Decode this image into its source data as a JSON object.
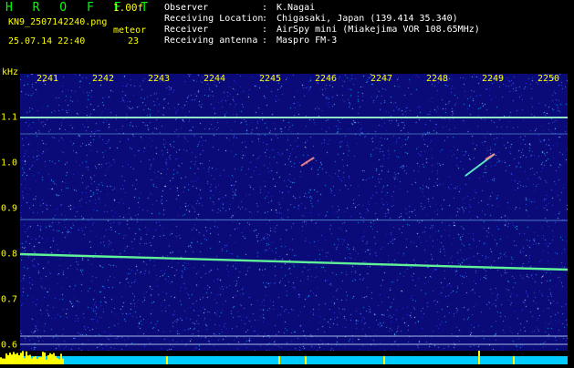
{
  "header": {
    "brand": "H R O F F T",
    "version": "1.00f",
    "filename": "KN9_2507142240.png",
    "meteor_title": "meteor",
    "datetime": "25.07.14 22:40",
    "meteor_count": "23",
    "info": [
      {
        "key": "Observer",
        "sep": ":",
        "value": "K.Nagai"
      },
      {
        "key": "Receiving Location",
        "sep": ":",
        "value": "Chigasaki, Japan (139.414 35.340)"
      },
      {
        "key": "Receiver",
        "sep": ":",
        "value": "AirSpy mini (Miakejima VOR 108.65MHz)"
      },
      {
        "key": "Receiving antenna",
        "sep": ":",
        "value": "Maspro FM-3"
      }
    ]
  },
  "axis": {
    "unit": "kHz",
    "time_ticks": [
      "2241",
      "2242",
      "2243",
      "2244",
      "2245",
      "2246",
      "2247",
      "2248",
      "2249",
      "2250"
    ],
    "freq_ticks": [
      "1.1",
      "1.0",
      "0.9",
      "0.8",
      "0.7",
      "0.6"
    ]
  },
  "colors": {
    "label": "#ffff00",
    "info": "#ffffff",
    "brand": "#00ff00",
    "background": "#0a0a78",
    "carrier": "#66ff99",
    "echo": "#ff8888",
    "baseline": "#00ccff"
  }
}
